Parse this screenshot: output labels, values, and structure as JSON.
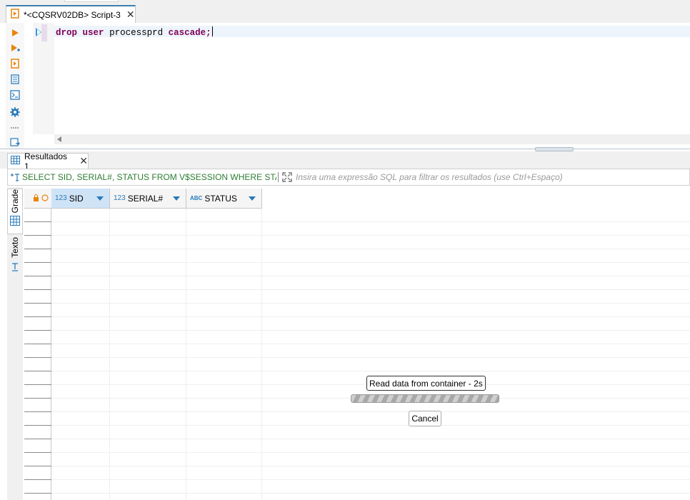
{
  "editor": {
    "tab_title": "*<CQSRV02DB> Script-3",
    "code": {
      "kw_drop": "drop",
      "kw_user": "user",
      "identifier": "processprd",
      "kw_cascade": "cascade;"
    }
  },
  "toolbar": {
    "items": [
      "execute-statement",
      "execute-in-new-tab",
      "execute-script",
      "explain-plan",
      "open-console",
      "settings",
      "more",
      "export"
    ]
  },
  "results": {
    "tab_label": "Resultados 1",
    "filter_sql": "SELECT SID, SERIAL#, STATUS FROM V$SESSION WHERE STATUS = 'I",
    "filter_placeholder": "Insira uma expressão SQL para filtrar os resultados (use Ctrl+Espaço)",
    "mode_grid_label": "Grade",
    "mode_text_label": "Texto",
    "columns": [
      {
        "type_label": "123",
        "name": "SID"
      },
      {
        "type_label": "123",
        "name": "SERIAL#"
      },
      {
        "type_label": "ABC",
        "name": "STATUS"
      }
    ]
  },
  "progress": {
    "message": "Read data from container - 2s",
    "cancel_label": "Cancel"
  },
  "colors": {
    "accent": "#3c7fb1",
    "keyword": "#7f0055",
    "filter_sql": "#2e7d32",
    "selected_header": "#cfe3f6",
    "toolbar_orange": "#e8840c"
  }
}
